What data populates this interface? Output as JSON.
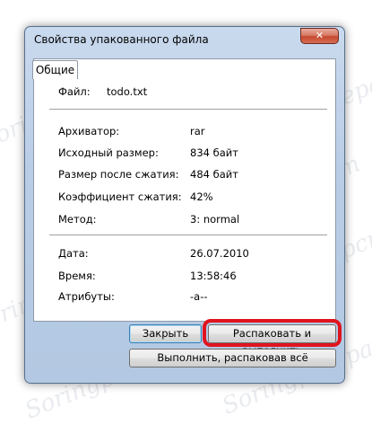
{
  "watermark_text": "Soringpcrepair.com",
  "dialog": {
    "title": "Свойства упакованного файла",
    "close_glyph": "✕",
    "tab": "Общие"
  },
  "file": {
    "label": "Файл:",
    "value": "todo.txt"
  },
  "properties": [
    {
      "label": "Архиватор:",
      "value": "rar"
    },
    {
      "label": "Исходный размер:",
      "value": "834 байт"
    },
    {
      "label": "Размер после сжатия:",
      "value": "484 байт"
    },
    {
      "label": "Коэффициент сжатия:",
      "value": "42%"
    },
    {
      "label": "Метод:",
      "value": "3: normal"
    }
  ],
  "times": [
    {
      "label": "Дата:",
      "value": "26.07.2010"
    },
    {
      "label": "Время:",
      "value": "13:58:46"
    },
    {
      "label": "Атрибуты:",
      "value": "-a--"
    }
  ],
  "buttons": {
    "close": "Закрыть",
    "extract_run": "Распаковать и выполнить",
    "run_extract_all": "Выполнить, распаковав всё"
  },
  "colors": {
    "highlight": "#e0141e",
    "window": "#c9daee"
  }
}
